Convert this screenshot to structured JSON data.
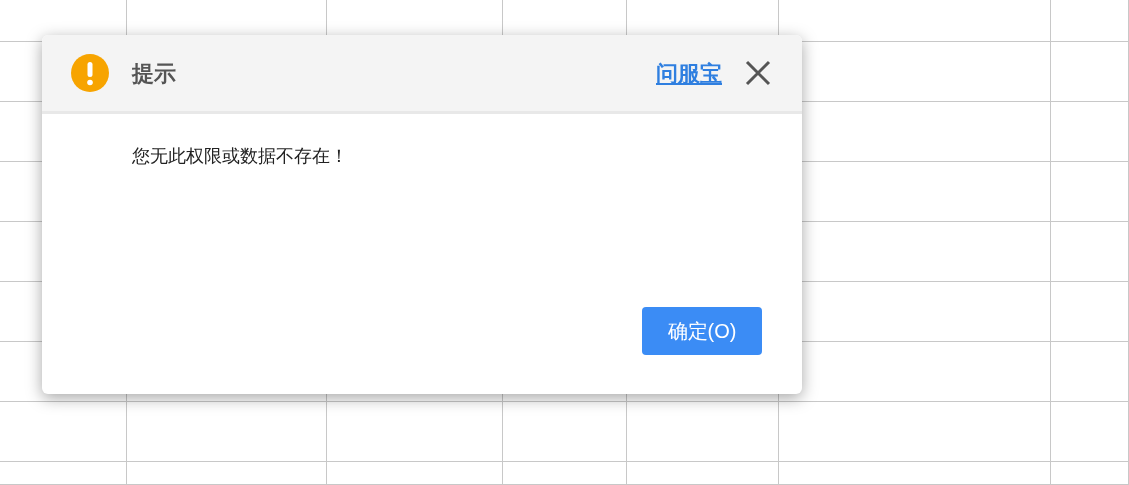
{
  "dialog": {
    "title": "提示",
    "help_link": "问服宝",
    "message": "您无此权限或数据不存在！",
    "buttons": [
      "确定(O)"
    ]
  }
}
